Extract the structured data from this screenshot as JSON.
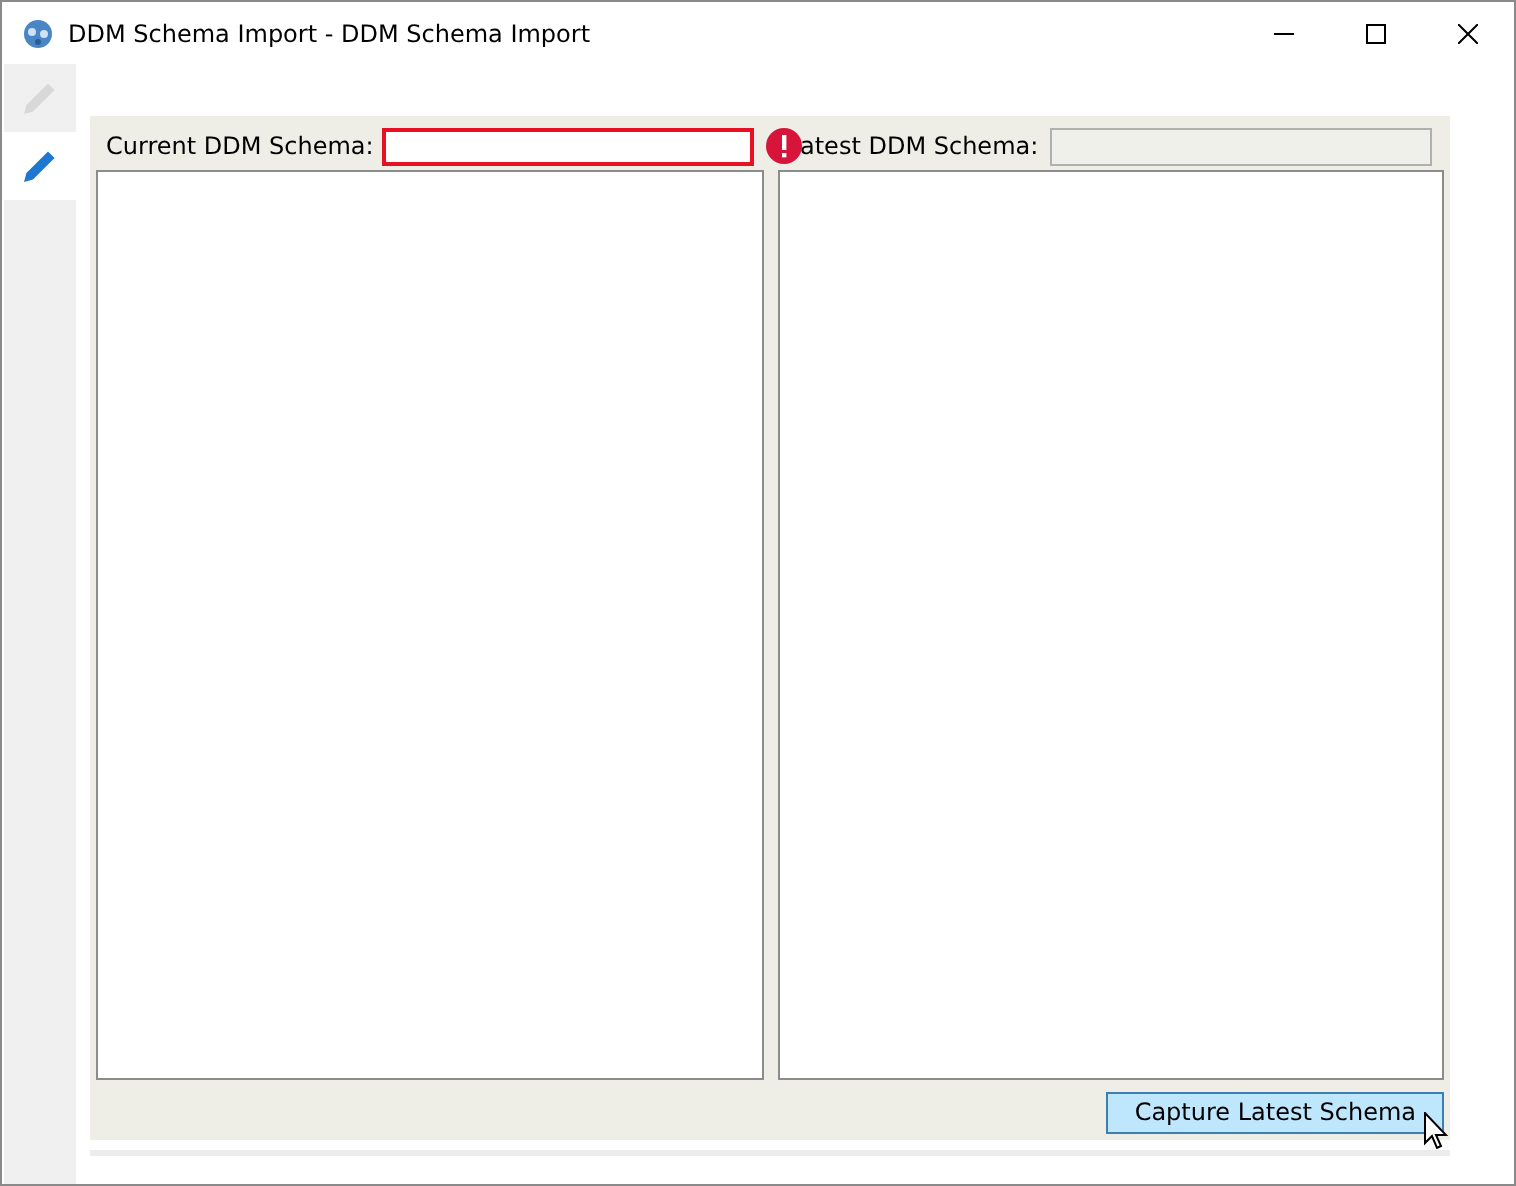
{
  "window": {
    "title": "DDM Schema Import - DDM Schema Import"
  },
  "sidebar": {
    "tabs": [
      {
        "selected": false
      },
      {
        "selected": true
      }
    ]
  },
  "current_schema": {
    "label": "Current DDM Schema:",
    "error": true
  },
  "latest_schema": {
    "label": "atest DDM Schema:",
    "disabled": true
  },
  "buttons": [
    {
      "label": "Capture Latest Schema",
      "hovered": true
    }
  ]
}
